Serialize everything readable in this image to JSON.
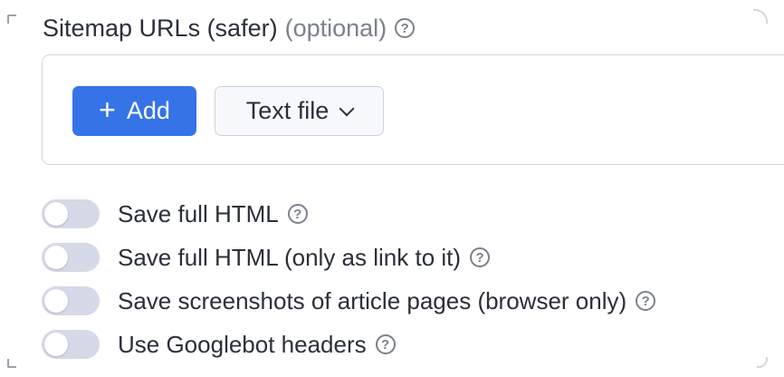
{
  "sitemap": {
    "title": "Sitemap URLs (safer)",
    "optional_label": "(optional)",
    "help_glyph": "?",
    "add_button_label": "Add",
    "add_button_icon": "+",
    "format_select_value": "Text file"
  },
  "options": [
    {
      "label": "Save full HTML",
      "enabled": false,
      "help_glyph": "?"
    },
    {
      "label": "Save full HTML (only as link to it)",
      "enabled": false,
      "help_glyph": "?"
    },
    {
      "label": "Save screenshots of article pages (browser only)",
      "enabled": false,
      "help_glyph": "?"
    },
    {
      "label": "Use Googlebot headers",
      "enabled": false,
      "help_glyph": "?"
    }
  ],
  "colors": {
    "accent": "#3573e6",
    "toggle_off": "#d5d9e8",
    "muted_text": "#7b818c",
    "text": "#2b2f3a"
  }
}
